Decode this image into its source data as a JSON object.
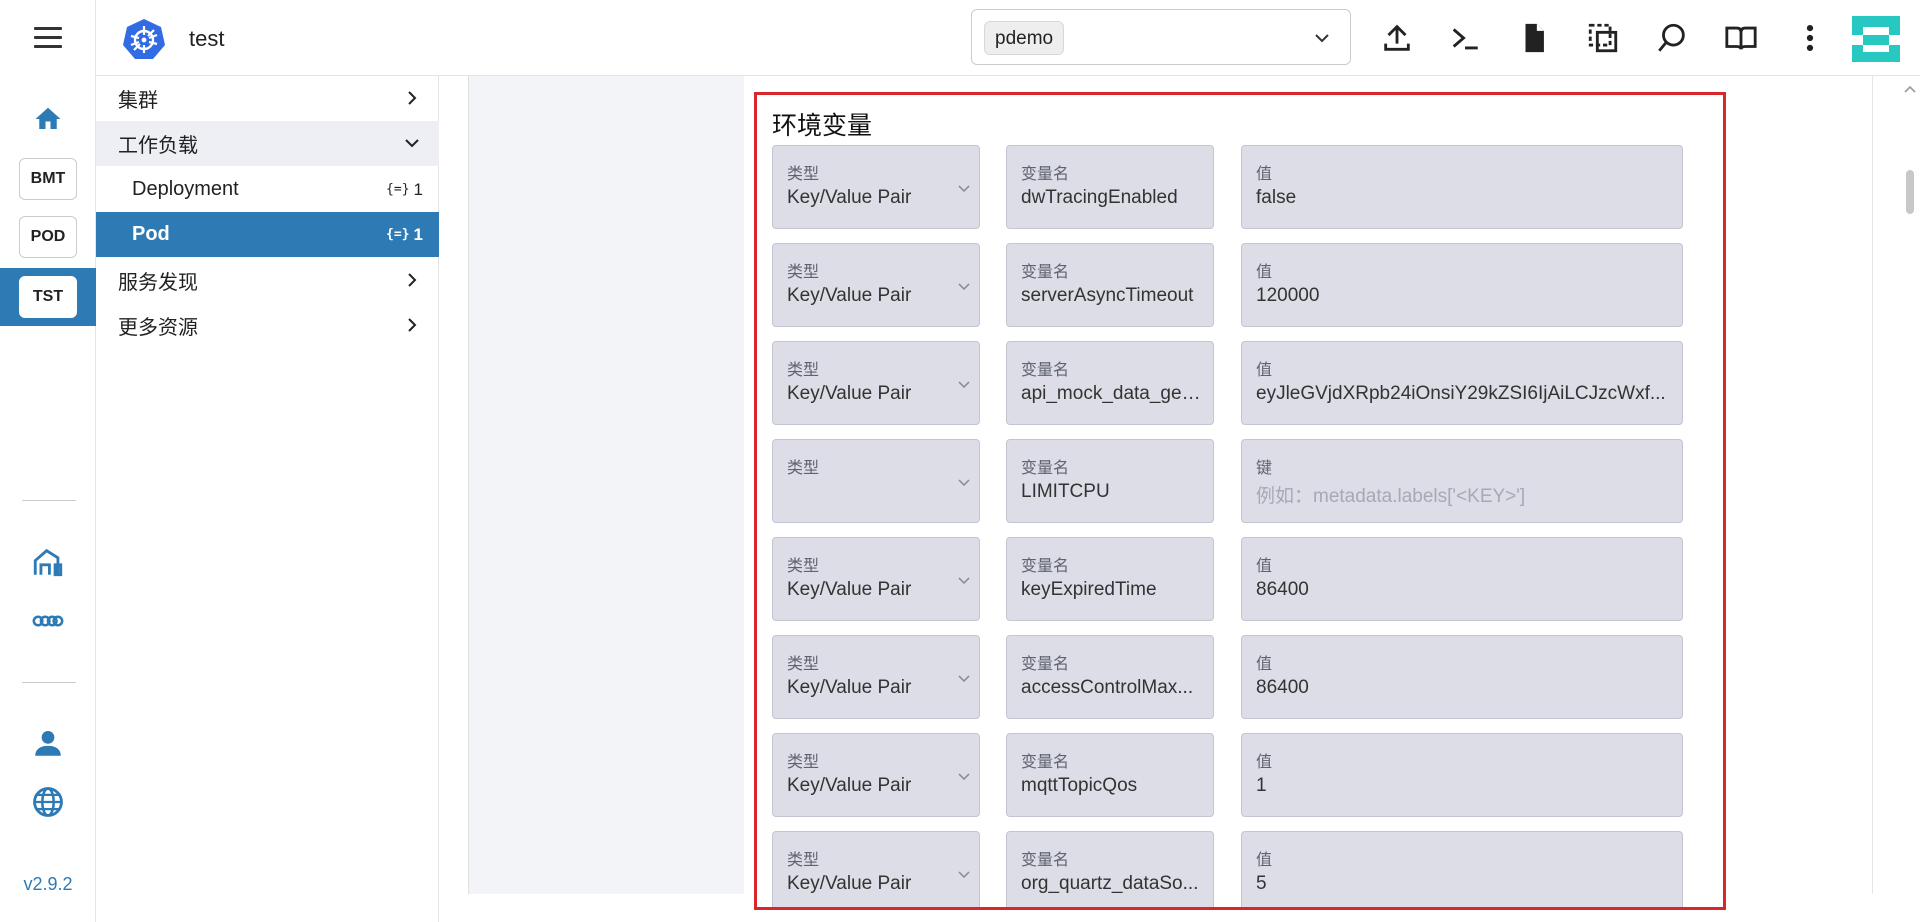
{
  "app": {
    "title": "test",
    "version": "v2.9.2"
  },
  "rail": {
    "clusters": [
      "BMT",
      "POD",
      "TST"
    ],
    "active_cluster": "TST"
  },
  "topbar": {
    "namespace": "pdemo"
  },
  "nav": {
    "items": [
      {
        "label": "集群"
      },
      {
        "label": "工作负载"
      },
      {
        "label": "Deployment",
        "count": "1"
      },
      {
        "label": "Pod",
        "count": "1"
      },
      {
        "label": "服务发现"
      },
      {
        "label": "更多资源"
      }
    ]
  },
  "env": {
    "title": "环境变量",
    "type_caption": "类型",
    "name_caption": "变量名",
    "rows": [
      {
        "type": "Key/Value Pair",
        "name": "dwTracingEnabled",
        "val_caption": "值",
        "value": "false"
      },
      {
        "type": "Key/Value Pair",
        "name": "serverAsyncTimeout",
        "val_caption": "值",
        "value": "120000"
      },
      {
        "type": "Key/Value Pair",
        "name": "api_mock_data_get...",
        "val_caption": "值",
        "value": "eyJleGVjdXRpb24iOnsiY29kZSI6IjAiLCJzcWxf..."
      },
      {
        "type": "",
        "name": "LIMITCPU",
        "val_caption": "键",
        "value": "例如：metadata.labels['<KEY>']"
      },
      {
        "type": "Key/Value Pair",
        "name": "keyExpiredTime",
        "val_caption": "值",
        "value": "86400"
      },
      {
        "type": "Key/Value Pair",
        "name": "accessControlMax...",
        "val_caption": "值",
        "value": "86400"
      },
      {
        "type": "Key/Value Pair",
        "name": "mqttTopicQos",
        "val_caption": "值",
        "value": "1"
      },
      {
        "type": "Key/Value Pair",
        "name": "org_quartz_dataSo...",
        "val_caption": "值",
        "value": "5"
      }
    ]
  },
  "colors": {
    "accent": "#2d7ab5",
    "highlight_border": "#d9262c",
    "field_bg": "#dcdde6"
  }
}
